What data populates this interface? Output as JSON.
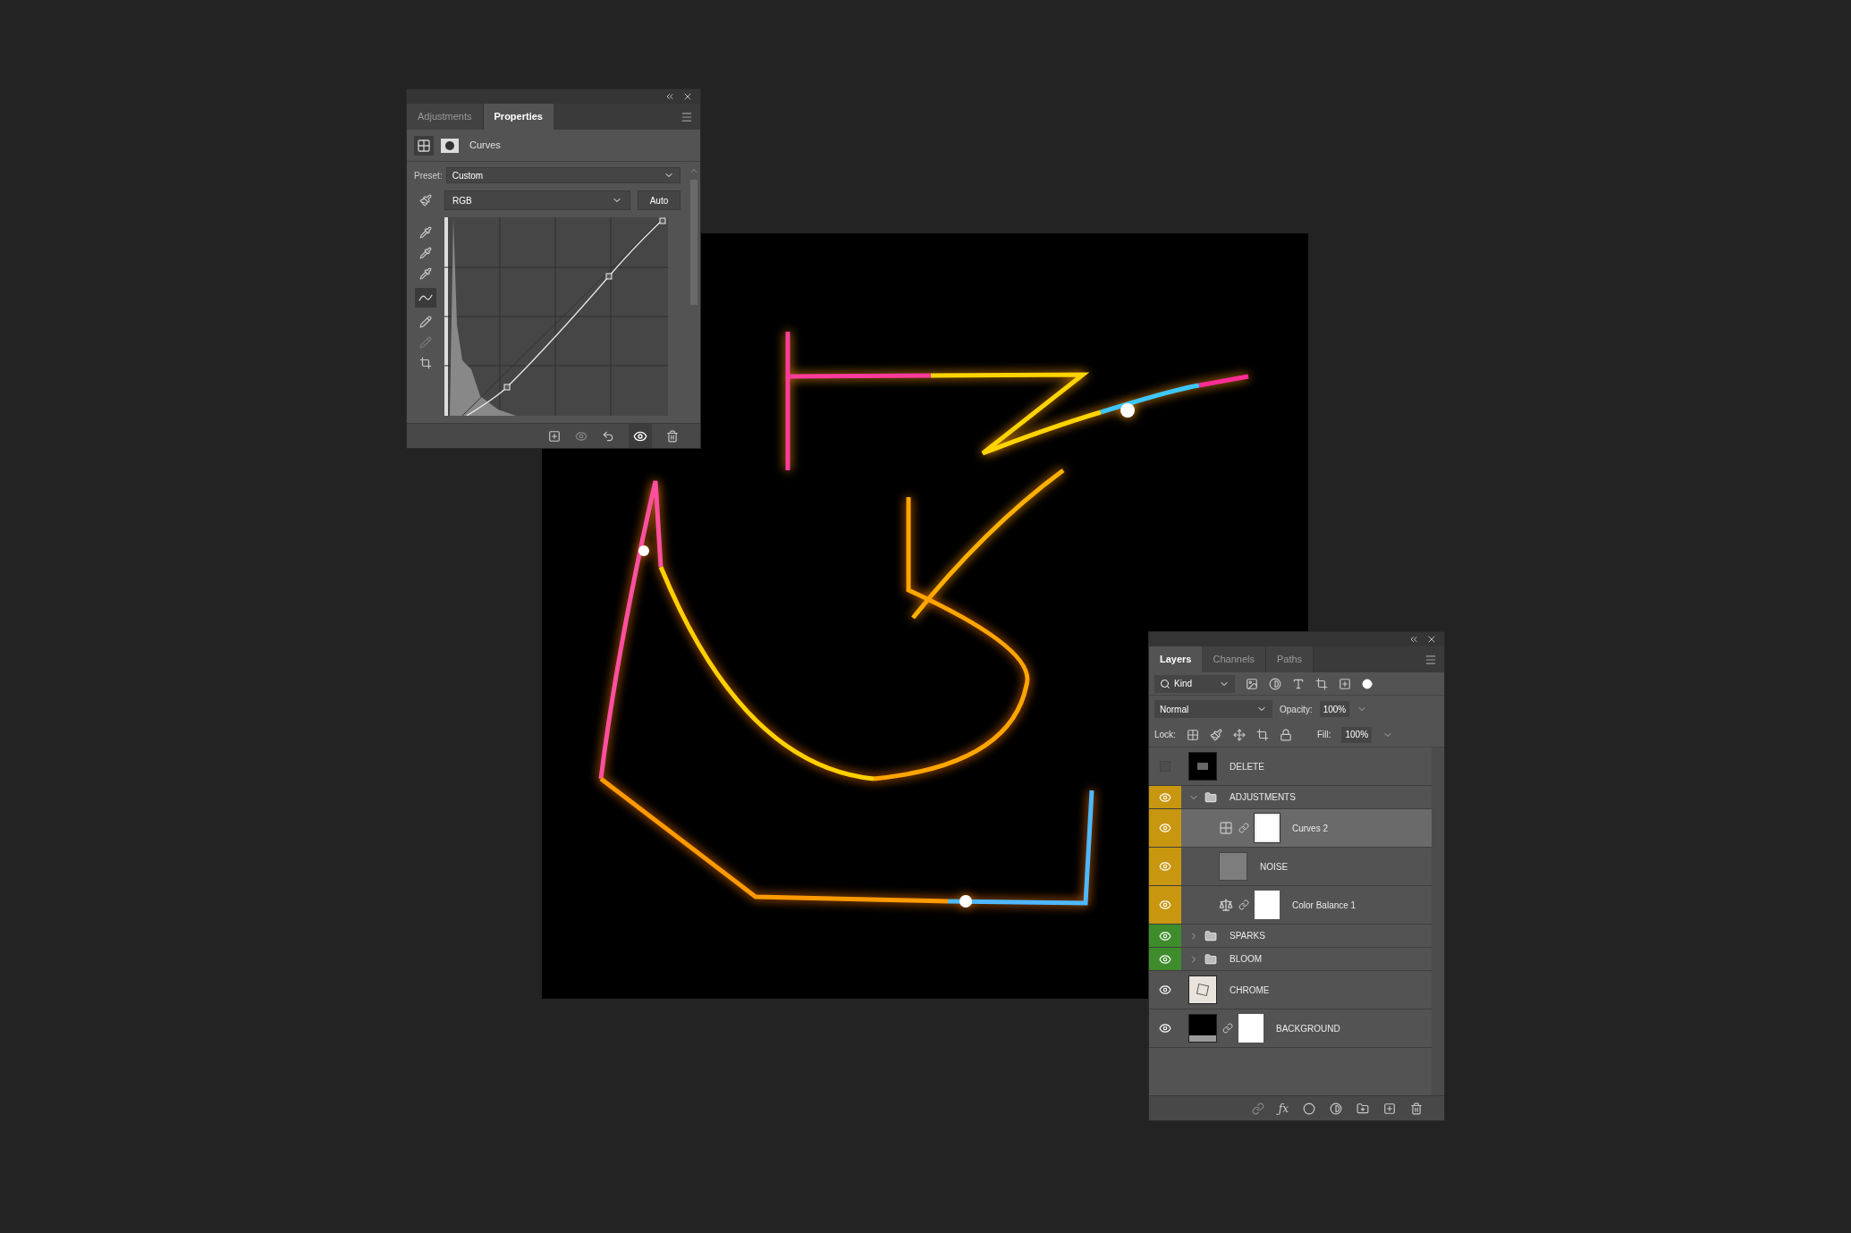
{
  "properties_panel": {
    "tabs": [
      {
        "label": "Adjustments",
        "selected": false
      },
      {
        "label": "Properties",
        "selected": true
      }
    ],
    "adjustment": {
      "title": "Curves"
    },
    "preset": {
      "label": "Preset:",
      "value": "Custom"
    },
    "channel": {
      "value": "RGB"
    },
    "auto_button": "Auto"
  },
  "layers_panel": {
    "tabs": [
      {
        "label": "Layers",
        "selected": true
      },
      {
        "label": "Channels",
        "selected": false
      },
      {
        "label": "Paths",
        "selected": false
      }
    ],
    "filter": {
      "value": "Kind"
    },
    "blend_mode": "Normal",
    "opacity": {
      "label": "Opacity:",
      "value": "100%"
    },
    "lock": {
      "label": "Lock:"
    },
    "fill": {
      "label": "Fill:",
      "value": "100%"
    },
    "fx_button": "ƒx",
    "layers": [
      {
        "name": "DELETE",
        "kind": "pixel",
        "visible": false,
        "mask": false,
        "selected": false
      },
      {
        "name": "ADJUSTMENTS",
        "kind": "group",
        "visible": true,
        "color": "#c8960f",
        "expanded": true,
        "selected": false,
        "children": [
          {
            "name": "Curves 2",
            "kind": "curves",
            "visible": true,
            "color": "#c8960f",
            "mask": true,
            "selected": true
          },
          {
            "name": "NOISE",
            "kind": "fill",
            "visible": true,
            "color": "#c8960f",
            "mask": false,
            "selected": false
          },
          {
            "name": "Color Balance 1",
            "kind": "balance",
            "visible": true,
            "color": "#c8960f",
            "mask": true,
            "selected": false
          }
        ]
      },
      {
        "name": "SPARKS",
        "kind": "group",
        "visible": true,
        "color": "#3f8c2c",
        "expanded": false,
        "selected": false
      },
      {
        "name": "BLOOM",
        "kind": "group",
        "visible": true,
        "color": "#3f8c2c",
        "expanded": false,
        "selected": false
      },
      {
        "name": "CHROME",
        "kind": "smart",
        "visible": true,
        "mask": false,
        "selected": false
      },
      {
        "name": "BACKGROUND",
        "kind": "pixel-dark",
        "visible": true,
        "mask": true,
        "selected": false
      }
    ]
  }
}
